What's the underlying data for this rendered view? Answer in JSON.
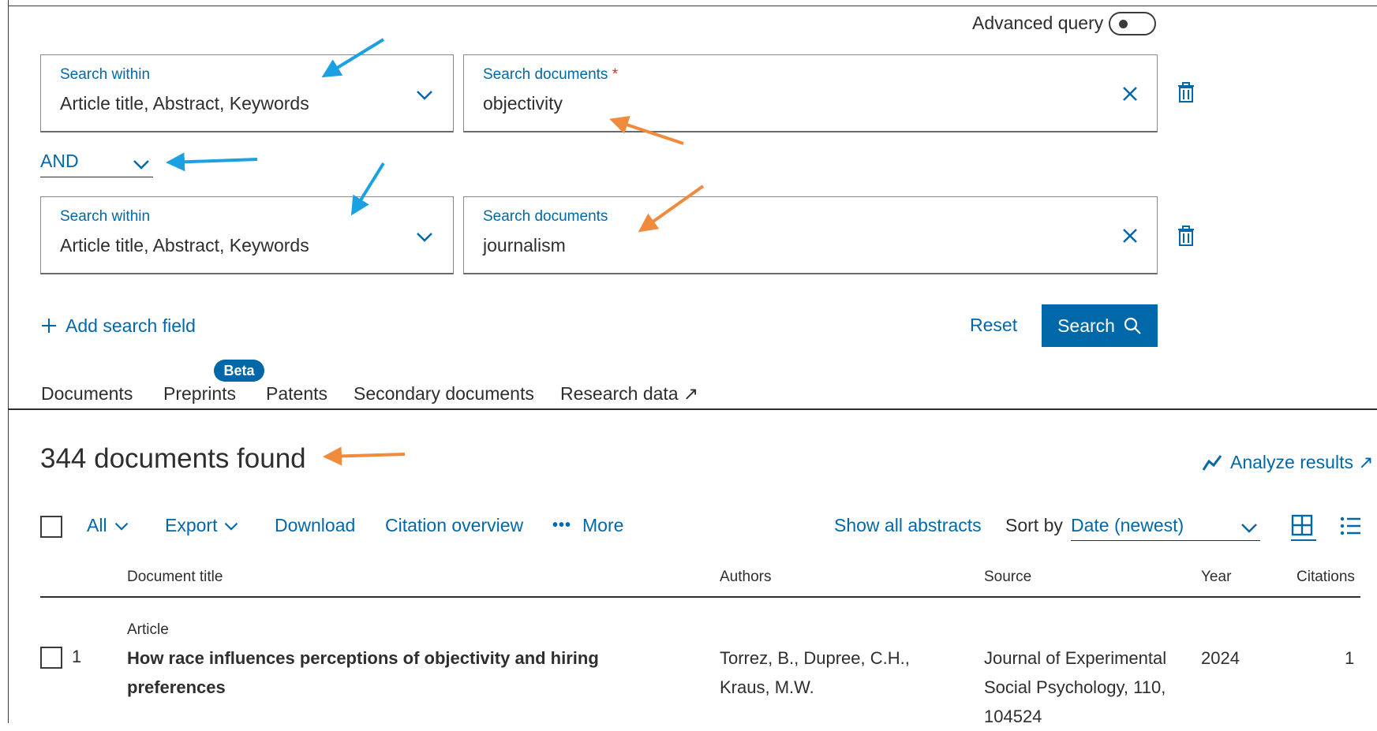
{
  "advanced_query_label": "Advanced query",
  "fields": [
    {
      "within_label": "Search within",
      "within_value": "Article title, Abstract, Keywords",
      "docs_label": "Search documents",
      "required_mark": "*",
      "docs_value": "objectivity"
    },
    {
      "within_label": "Search within",
      "within_value": "Article title, Abstract, Keywords",
      "docs_label": "Search documents",
      "docs_value": "journalism"
    }
  ],
  "operator": "AND",
  "add_field_label": "Add search field",
  "reset_label": "Reset",
  "search_label": "Search",
  "tabs": {
    "documents": "Documents",
    "preprints": "Preprints",
    "beta": "Beta",
    "patents": "Patents",
    "secondary": "Secondary documents",
    "research_data": "Research data ↗"
  },
  "results_count_text": "344 documents found",
  "analyze_label": "Analyze results ↗",
  "toolbar": {
    "all": "All",
    "export": "Export",
    "download": "Download",
    "citation_overview": "Citation overview",
    "more": "More",
    "show_abstracts": "Show all abstracts",
    "sort_by": "Sort by",
    "sort_value": "Date (newest)"
  },
  "columns": {
    "title": "Document title",
    "authors": "Authors",
    "source": "Source",
    "year": "Year",
    "citations": "Citations"
  },
  "rows": [
    {
      "index": "1",
      "doc_type": "Article",
      "title_line1": "How race influences perceptions of objectivity and hiring",
      "title_line2": "preferences",
      "authors_line1": "Torrez, B., Dupree, C.H.,",
      "authors_line2": "Kraus, M.W.",
      "source_line1": "Journal of Experimental",
      "source_line2": "Social Psychology, 110,",
      "source_line3": "104524",
      "year": "2024",
      "citations": "1"
    }
  ],
  "colors": {
    "accent": "#0068a8",
    "annotation_blue": "#1ba1e2",
    "annotation_orange": "#f08a3c",
    "required": "#d0361f"
  }
}
